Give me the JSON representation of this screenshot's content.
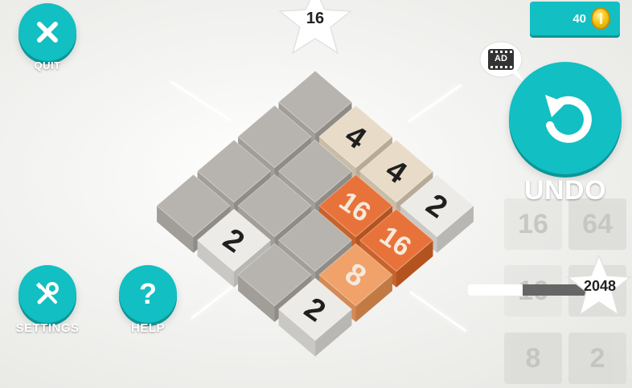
{
  "top": {
    "score": "16"
  },
  "coins": {
    "value": "40"
  },
  "ad_badge": {
    "label": "AD"
  },
  "buttons": {
    "quit_label": "QUIT",
    "undo_label": "UNDO",
    "settings_label": "SETTINGS",
    "help_label": "HELP",
    "help_glyph": "?"
  },
  "goal": {
    "target": "2048",
    "progress_fraction": 0.45
  },
  "board": {
    "tiles": [
      {
        "value": "",
        "kind": "empty"
      },
      {
        "value": "4",
        "kind": "cream"
      },
      {
        "value": "4",
        "kind": "cream"
      },
      {
        "value": "2",
        "kind": "white"
      },
      {
        "value": "",
        "kind": "empty"
      },
      {
        "value": "",
        "kind": "empty"
      },
      {
        "value": "16",
        "kind": "orange"
      },
      {
        "value": "16",
        "kind": "orange"
      },
      {
        "value": "",
        "kind": "empty"
      },
      {
        "value": "",
        "kind": "empty"
      },
      {
        "value": "",
        "kind": "empty"
      },
      {
        "value": "8",
        "kind": "light-orange"
      },
      {
        "value": "",
        "kind": "empty"
      },
      {
        "value": "2",
        "kind": "white"
      },
      {
        "value": "",
        "kind": "empty"
      },
      {
        "value": "2",
        "kind": "white"
      }
    ]
  },
  "background_tiles": [
    "64",
    "16",
    "8",
    "2"
  ],
  "colors": {
    "accent": "#12bfc2",
    "tile_empty": "#b7b3ae",
    "tile_white": "#ecebe8",
    "tile_cream": "#e8dcc8",
    "tile_orange": "#e8733a",
    "tile_light_orange": "#f0a26a"
  }
}
